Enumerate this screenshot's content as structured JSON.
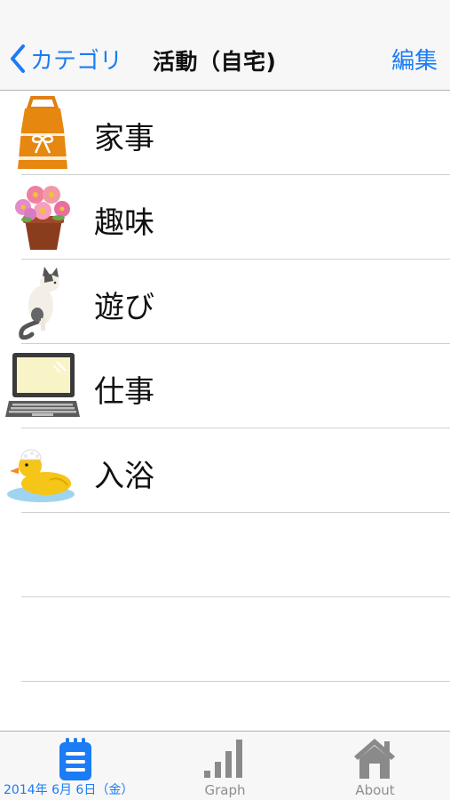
{
  "nav": {
    "back_label": "カテゴリ",
    "title": "活動（自宅)",
    "edit_label": "編集"
  },
  "activities": [
    {
      "label": "家事",
      "icon": "apron-icon"
    },
    {
      "label": "趣味",
      "icon": "flower-pot-icon"
    },
    {
      "label": "遊び",
      "icon": "cat-icon"
    },
    {
      "label": "仕事",
      "icon": "laptop-icon"
    },
    {
      "label": "入浴",
      "icon": "rubber-duck-icon"
    }
  ],
  "tabs": [
    {
      "label": "2014年 6月 6日（金）",
      "icon": "notepad-icon",
      "active": true
    },
    {
      "label": "Graph",
      "icon": "bar-graph-icon",
      "active": false
    },
    {
      "label": "About",
      "icon": "house-icon",
      "active": false
    }
  ],
  "colors": {
    "accent": "#1b7cf5",
    "inactive_tab": "#8e8e93",
    "separator": "#d0d0d0"
  }
}
